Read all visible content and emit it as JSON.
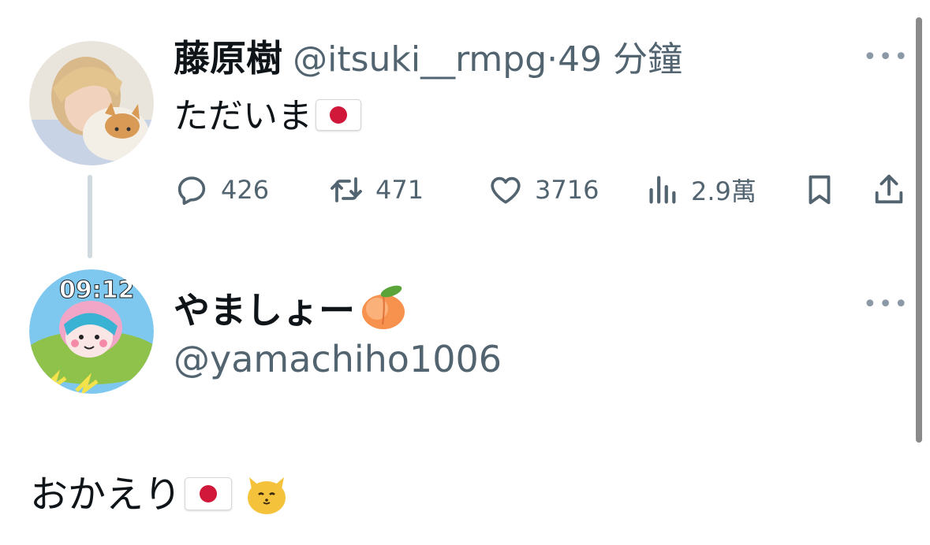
{
  "tweet": {
    "author_name": "藤原樹",
    "author_handle": "@itsuki__rmpg",
    "time_sep": "·",
    "time": "49 分鐘",
    "text": "ただいま",
    "text_emoji": "japan-flag",
    "more_glyph": "•••",
    "actions": {
      "reply_count": "426",
      "retweet_count": "471",
      "like_count": "3716",
      "views_count": "2.9萬"
    }
  },
  "reply": {
    "author_name": "やましょー",
    "author_name_emoji": "peach-emoji",
    "author_handle": "@yamachiho1006",
    "more_glyph": "•••",
    "avatar_clock": "09:12",
    "text": "おかえり",
    "text_emojis": [
      "japan-flag",
      "cat-face-emoji"
    ]
  },
  "colors": {
    "text_primary": "#0f1419",
    "text_secondary": "#536471",
    "thread_line": "#cfd9de",
    "flag_red": "#d1173a"
  }
}
